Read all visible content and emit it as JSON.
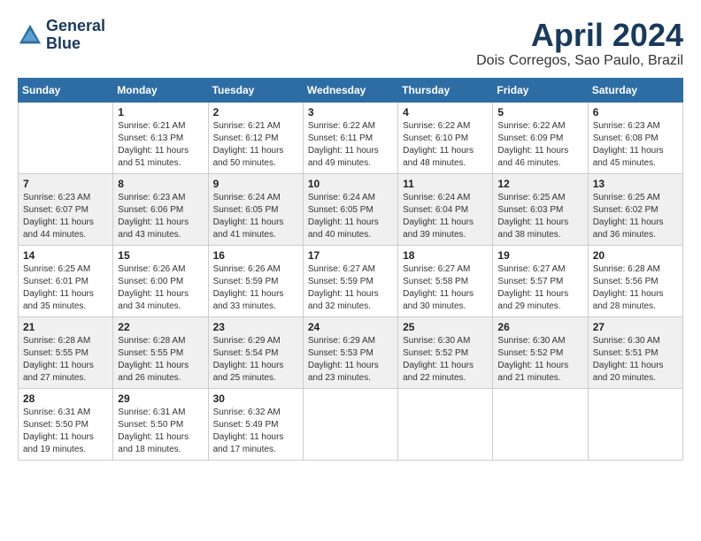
{
  "logo": {
    "line1": "General",
    "line2": "Blue"
  },
  "title": "April 2024",
  "location": "Dois Corregos, Sao Paulo, Brazil",
  "headers": [
    "Sunday",
    "Monday",
    "Tuesday",
    "Wednesday",
    "Thursday",
    "Friday",
    "Saturday"
  ],
  "weeks": [
    [
      {
        "day": "",
        "sunrise": "",
        "sunset": "",
        "daylight": ""
      },
      {
        "day": "1",
        "sunrise": "Sunrise: 6:21 AM",
        "sunset": "Sunset: 6:13 PM",
        "daylight": "Daylight: 11 hours and 51 minutes."
      },
      {
        "day": "2",
        "sunrise": "Sunrise: 6:21 AM",
        "sunset": "Sunset: 6:12 PM",
        "daylight": "Daylight: 11 hours and 50 minutes."
      },
      {
        "day": "3",
        "sunrise": "Sunrise: 6:22 AM",
        "sunset": "Sunset: 6:11 PM",
        "daylight": "Daylight: 11 hours and 49 minutes."
      },
      {
        "day": "4",
        "sunrise": "Sunrise: 6:22 AM",
        "sunset": "Sunset: 6:10 PM",
        "daylight": "Daylight: 11 hours and 48 minutes."
      },
      {
        "day": "5",
        "sunrise": "Sunrise: 6:22 AM",
        "sunset": "Sunset: 6:09 PM",
        "daylight": "Daylight: 11 hours and 46 minutes."
      },
      {
        "day": "6",
        "sunrise": "Sunrise: 6:23 AM",
        "sunset": "Sunset: 6:08 PM",
        "daylight": "Daylight: 11 hours and 45 minutes."
      }
    ],
    [
      {
        "day": "7",
        "sunrise": "Sunrise: 6:23 AM",
        "sunset": "Sunset: 6:07 PM",
        "daylight": "Daylight: 11 hours and 44 minutes."
      },
      {
        "day": "8",
        "sunrise": "Sunrise: 6:23 AM",
        "sunset": "Sunset: 6:06 PM",
        "daylight": "Daylight: 11 hours and 43 minutes."
      },
      {
        "day": "9",
        "sunrise": "Sunrise: 6:24 AM",
        "sunset": "Sunset: 6:05 PM",
        "daylight": "Daylight: 11 hours and 41 minutes."
      },
      {
        "day": "10",
        "sunrise": "Sunrise: 6:24 AM",
        "sunset": "Sunset: 6:05 PM",
        "daylight": "Daylight: 11 hours and 40 minutes."
      },
      {
        "day": "11",
        "sunrise": "Sunrise: 6:24 AM",
        "sunset": "Sunset: 6:04 PM",
        "daylight": "Daylight: 11 hours and 39 minutes."
      },
      {
        "day": "12",
        "sunrise": "Sunrise: 6:25 AM",
        "sunset": "Sunset: 6:03 PM",
        "daylight": "Daylight: 11 hours and 38 minutes."
      },
      {
        "day": "13",
        "sunrise": "Sunrise: 6:25 AM",
        "sunset": "Sunset: 6:02 PM",
        "daylight": "Daylight: 11 hours and 36 minutes."
      }
    ],
    [
      {
        "day": "14",
        "sunrise": "Sunrise: 6:25 AM",
        "sunset": "Sunset: 6:01 PM",
        "daylight": "Daylight: 11 hours and 35 minutes."
      },
      {
        "day": "15",
        "sunrise": "Sunrise: 6:26 AM",
        "sunset": "Sunset: 6:00 PM",
        "daylight": "Daylight: 11 hours and 34 minutes."
      },
      {
        "day": "16",
        "sunrise": "Sunrise: 6:26 AM",
        "sunset": "Sunset: 5:59 PM",
        "daylight": "Daylight: 11 hours and 33 minutes."
      },
      {
        "day": "17",
        "sunrise": "Sunrise: 6:27 AM",
        "sunset": "Sunset: 5:59 PM",
        "daylight": "Daylight: 11 hours and 32 minutes."
      },
      {
        "day": "18",
        "sunrise": "Sunrise: 6:27 AM",
        "sunset": "Sunset: 5:58 PM",
        "daylight": "Daylight: 11 hours and 30 minutes."
      },
      {
        "day": "19",
        "sunrise": "Sunrise: 6:27 AM",
        "sunset": "Sunset: 5:57 PM",
        "daylight": "Daylight: 11 hours and 29 minutes."
      },
      {
        "day": "20",
        "sunrise": "Sunrise: 6:28 AM",
        "sunset": "Sunset: 5:56 PM",
        "daylight": "Daylight: 11 hours and 28 minutes."
      }
    ],
    [
      {
        "day": "21",
        "sunrise": "Sunrise: 6:28 AM",
        "sunset": "Sunset: 5:55 PM",
        "daylight": "Daylight: 11 hours and 27 minutes."
      },
      {
        "day": "22",
        "sunrise": "Sunrise: 6:28 AM",
        "sunset": "Sunset: 5:55 PM",
        "daylight": "Daylight: 11 hours and 26 minutes."
      },
      {
        "day": "23",
        "sunrise": "Sunrise: 6:29 AM",
        "sunset": "Sunset: 5:54 PM",
        "daylight": "Daylight: 11 hours and 25 minutes."
      },
      {
        "day": "24",
        "sunrise": "Sunrise: 6:29 AM",
        "sunset": "Sunset: 5:53 PM",
        "daylight": "Daylight: 11 hours and 23 minutes."
      },
      {
        "day": "25",
        "sunrise": "Sunrise: 6:30 AM",
        "sunset": "Sunset: 5:52 PM",
        "daylight": "Daylight: 11 hours and 22 minutes."
      },
      {
        "day": "26",
        "sunrise": "Sunrise: 6:30 AM",
        "sunset": "Sunset: 5:52 PM",
        "daylight": "Daylight: 11 hours and 21 minutes."
      },
      {
        "day": "27",
        "sunrise": "Sunrise: 6:30 AM",
        "sunset": "Sunset: 5:51 PM",
        "daylight": "Daylight: 11 hours and 20 minutes."
      }
    ],
    [
      {
        "day": "28",
        "sunrise": "Sunrise: 6:31 AM",
        "sunset": "Sunset: 5:50 PM",
        "daylight": "Daylight: 11 hours and 19 minutes."
      },
      {
        "day": "29",
        "sunrise": "Sunrise: 6:31 AM",
        "sunset": "Sunset: 5:50 PM",
        "daylight": "Daylight: 11 hours and 18 minutes."
      },
      {
        "day": "30",
        "sunrise": "Sunrise: 6:32 AM",
        "sunset": "Sunset: 5:49 PM",
        "daylight": "Daylight: 11 hours and 17 minutes."
      },
      {
        "day": "",
        "sunrise": "",
        "sunset": "",
        "daylight": ""
      },
      {
        "day": "",
        "sunrise": "",
        "sunset": "",
        "daylight": ""
      },
      {
        "day": "",
        "sunrise": "",
        "sunset": "",
        "daylight": ""
      },
      {
        "day": "",
        "sunrise": "",
        "sunset": "",
        "daylight": ""
      }
    ]
  ]
}
